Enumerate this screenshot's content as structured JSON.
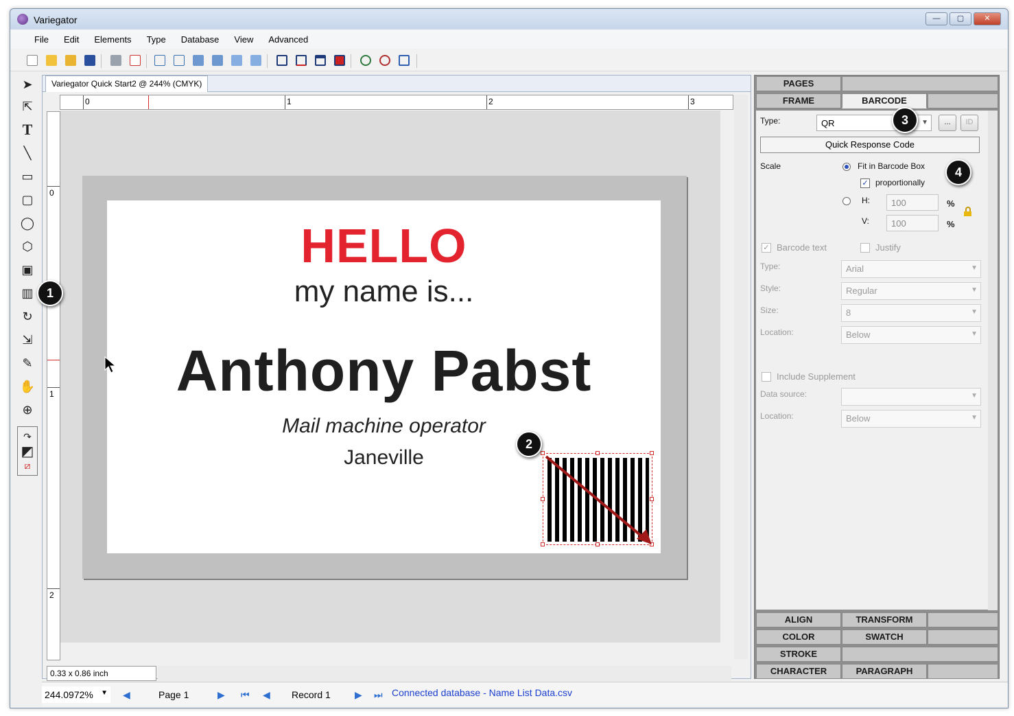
{
  "window": {
    "title": "Variegator",
    "controls": {
      "minimize": "—",
      "maximize": "▢",
      "close": "✕"
    }
  },
  "menu": [
    "File",
    "Edit",
    "Elements",
    "Type",
    "Database",
    "View",
    "Advanced"
  ],
  "toolbar_icons": [
    "new-icon",
    "open-icon",
    "open-folder-icon",
    "save-icon",
    "print-icon",
    "pdf-icon",
    "align-icon",
    "distribute-icon",
    "bring-forward-icon",
    "send-backward-icon",
    "bring-front-icon",
    "send-back-icon",
    "frame-icon",
    "frame-bottom-icon",
    "frame-top-icon",
    "frame-fill-icon",
    "zoom-in-icon",
    "zoom-out-icon",
    "zoom-fit-icon"
  ],
  "tools": [
    "select-arrow-icon",
    "direct-select-icon",
    "text-tool-icon",
    "line-tool-icon",
    "rectangle-tool-icon",
    "rounded-rect-tool-icon",
    "ellipse-tool-icon",
    "polygon-tool-icon",
    "image-tool-icon",
    "barcode-tool-icon",
    "rotate-tool-icon",
    "scale-tool-icon",
    "eyedropper-tool-icon",
    "hand-tool-icon",
    "zoom-tool-icon"
  ],
  "document": {
    "tab": "Variegator Quick Start2 @ 244% (CMYK)",
    "ruler_h": [
      "0",
      "1",
      "2",
      "3"
    ],
    "ruler_v": [
      "0",
      "1",
      "2"
    ],
    "size_readout": "0.33 x 0.86 inch"
  },
  "card": {
    "hello": "HELLO",
    "my_name": "my name is...",
    "person": "Anthony Pabst",
    "job": "Mail machine operator",
    "city": "Janeville"
  },
  "status": {
    "zoom": "244.0972%",
    "page": "Page 1",
    "record": "Record 1",
    "connection": "Connected database - Name List Data.csv"
  },
  "panel": {
    "top_tabs": [
      "PAGES",
      "FRAME",
      "BARCODE"
    ],
    "type_label": "Type:",
    "type_value": "QR",
    "more_button": "...",
    "id_button": "ID",
    "barcode_name": "Quick Response Code",
    "scale_label": "Scale",
    "fit_label": "Fit in Barcode Box",
    "proportionally_label": "proportionally",
    "h_label": "H:",
    "v_label": "V:",
    "h_value": "100",
    "v_value": "100",
    "percent": "%",
    "barcode_text_label": "Barcode text",
    "justify_label": "Justify",
    "font_type_label": "Type:",
    "font_type_value": "Arial",
    "style_label": "Style:",
    "style_value": "Regular",
    "size_label": "Size:",
    "size_value": "8",
    "location_label": "Location:",
    "location_value": "Below",
    "include_supplement_label": "Include Supplement",
    "data_source_label": "Data source:",
    "data_source_value": "",
    "location2_label": "Location:",
    "location2_value": "Below",
    "bottom_tabs": [
      "ALIGN",
      "TRANSFORM",
      "COLOR",
      "SWATCH",
      "STROKE",
      "CHARACTER",
      "PARAGRAPH"
    ]
  },
  "markers": [
    "1",
    "2",
    "3",
    "4"
  ],
  "colors": {
    "hello_red": "#e3232d",
    "link_blue": "#1a3ecf",
    "selection_red": "#d42a2a"
  }
}
